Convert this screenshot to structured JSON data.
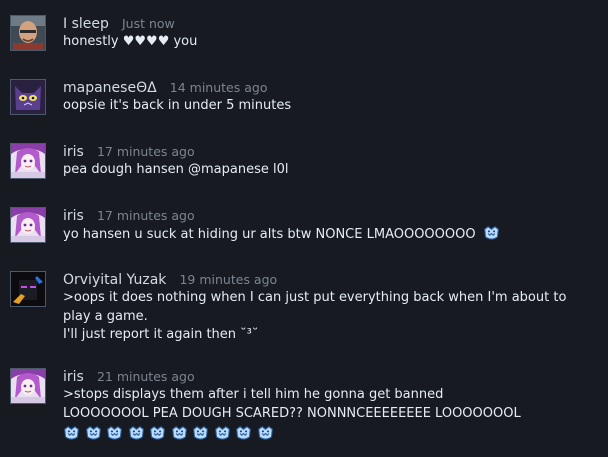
{
  "colors": {
    "background": "#171a21",
    "author": "#d2dbe3",
    "timestamp": "#7b8591",
    "text": "#e6edf2"
  },
  "comments": [
    {
      "author": "I sleep",
      "time": "Just now",
      "avatar": "bald-man-avatar",
      "lines": [
        "honestly ♥♥♥♥ you"
      ]
    },
    {
      "author": "mapaneseΘΔ",
      "time": "14 minutes ago",
      "avatar": "purple-cat-avatar",
      "lines": [
        "oopsie it's back in under 5 minutes"
      ]
    },
    {
      "author": "iris",
      "time": "17 minutes ago",
      "avatar": "anime-girl-avatar",
      "lines": [
        "pea dough hansen @mapanese l0l"
      ]
    },
    {
      "author": "iris",
      "time": "17 minutes ago",
      "avatar": "anime-girl-avatar",
      "lines": [
        "yo hansen u suck at hiding ur alts btw NONCE LMAOOOOOOOO"
      ],
      "emote": "shark-emote"
    },
    {
      "author": "Orviyital Yuzak",
      "time": "19 minutes ago",
      "avatar": "enderman-avatar",
      "lines": [
        ">oops it does nothing when I can just put everything back when I'm about to play a game.",
        "I'll just report it again then ˘³˘"
      ]
    },
    {
      "author": "iris",
      "time": "21 minutes ago",
      "avatar": "anime-girl-avatar",
      "lines": [
        ">stops displays them after i tell him he gonna get banned",
        "LOOOOOOOL PEA DOUGH SCARED?? NONNNCEEEEEEEE LOOOOOOOL"
      ],
      "emote_row": 10,
      "emote": "shark-emote"
    }
  ]
}
